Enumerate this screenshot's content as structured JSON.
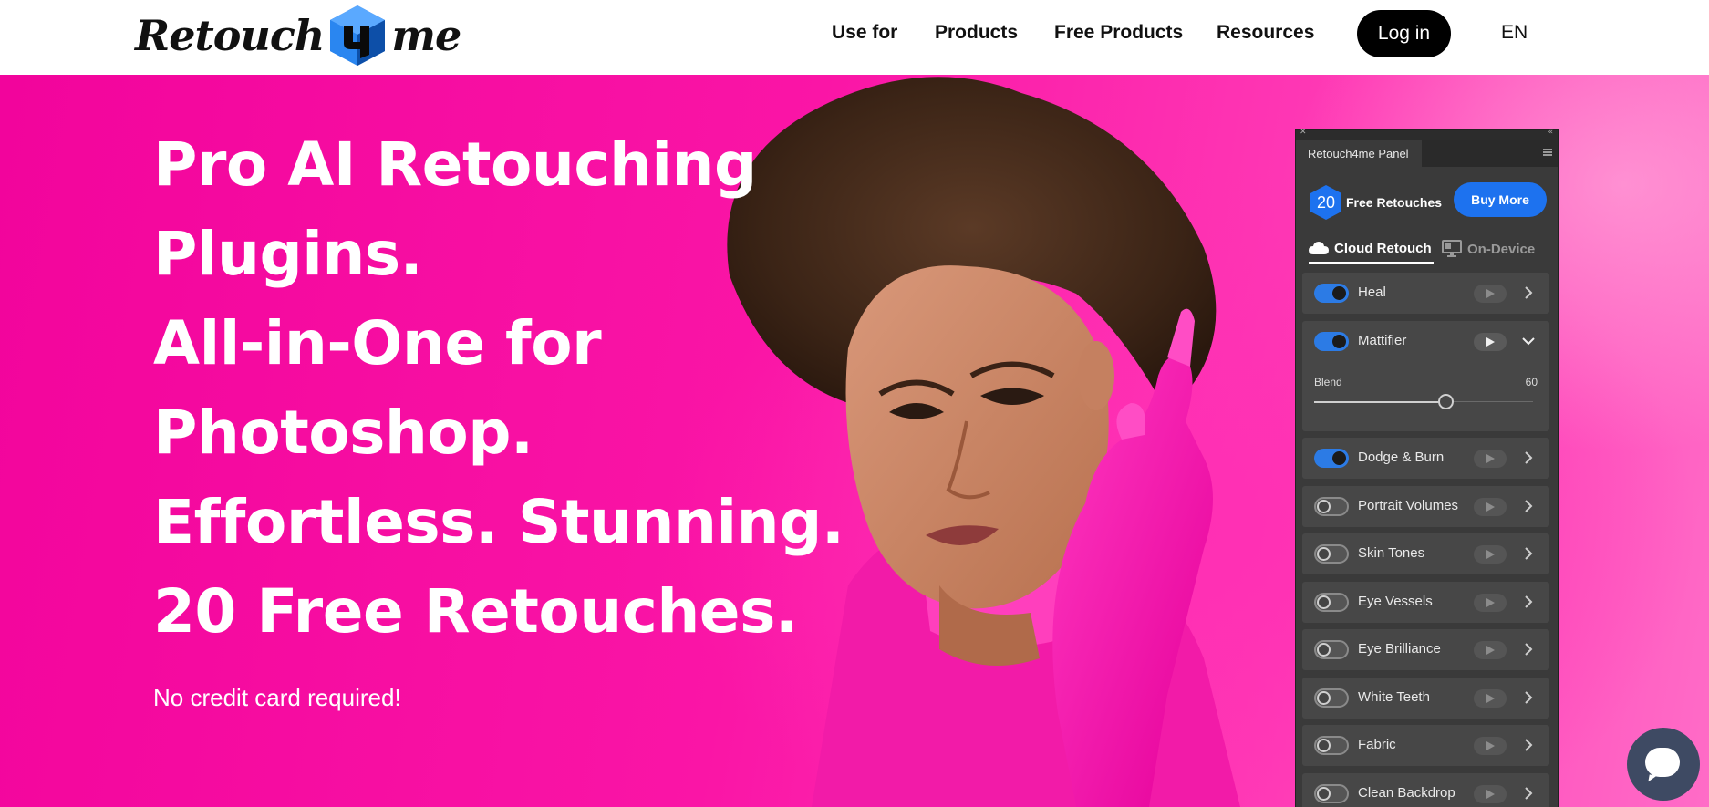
{
  "header": {
    "logo_left": "Retouch",
    "logo_right": "me",
    "nav": [
      "Use for",
      "Products",
      "Free Products",
      "Resources"
    ],
    "login_label": "Log in",
    "language": "EN"
  },
  "hero": {
    "headline": [
      "Pro AI Retouching",
      "Plugins.",
      "All-in-One for",
      "Photoshop.",
      "Effortless. Stunning.",
      "20 Free Retouches."
    ],
    "subline": "No credit card required!",
    "background_color": "#f80aa1"
  },
  "panel": {
    "tab_title": "Retouch4me Panel",
    "credits_count": "20",
    "credits_label": "Free Retouches",
    "buy_label": "Buy More",
    "mode_tabs": {
      "active": "Cloud Retouch",
      "inactive": "On-Device"
    },
    "rows": [
      {
        "label": "Heal",
        "enabled": true
      },
      {
        "label": "Mattifier",
        "enabled": true,
        "expanded": true,
        "blend_label": "Blend",
        "blend_value": "60"
      },
      {
        "label": "Dodge & Burn",
        "enabled": true
      },
      {
        "label": "Portrait Volumes",
        "enabled": false
      },
      {
        "label": "Skin Tones",
        "enabled": false
      },
      {
        "label": "Eye Vessels",
        "enabled": false
      },
      {
        "label": "Eye Brilliance",
        "enabled": false
      },
      {
        "label": "White Teeth",
        "enabled": false
      },
      {
        "label": "Fabric",
        "enabled": false
      },
      {
        "label": "Clean Backdrop",
        "enabled": false
      }
    ],
    "accent_color": "#1d72ef",
    "slider_fraction": 0.6
  },
  "icons": {
    "cloud": "cloud-icon",
    "device": "monitor-icon",
    "chat": "chat-icon",
    "play": "play-icon",
    "chevron_right": "chevron-right-icon",
    "chevron_down": "chevron-down-icon"
  }
}
